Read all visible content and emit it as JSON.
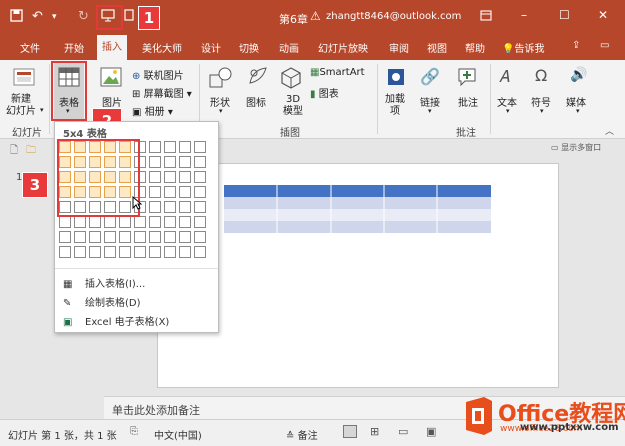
{
  "titlebar": {
    "title": "第6章",
    "account": "zhangtt8464@outlook.com",
    "warning_icon": "warning-icon",
    "window_min": "–",
    "window_max": "☐",
    "window_close": "✕"
  },
  "tabs": [
    "文件",
    "开始",
    "插入",
    "美化大师",
    "设计",
    "切换",
    "动画",
    "幻灯片放映",
    "审阅",
    "视图",
    "帮助"
  ],
  "tell_me": "告诉我",
  "ribbon": {
    "new_slide": "新建\n幻灯片",
    "table": "表格",
    "picture": "图片",
    "online_picture": "联机图片",
    "screenshot": "屏幕截图",
    "album": "相册",
    "shapes": "形状",
    "icons": "图标",
    "model3d": "3D\n模型",
    "smartart": "SmartArt",
    "chart": "图表",
    "addins": "加载\n项",
    "link": "链接",
    "comment": "批注",
    "text": "文本",
    "symbol": "符号",
    "media": "媒体",
    "group_slides": "幻灯片",
    "group_illustrations": "插图",
    "group_comments": "批注",
    "show_multi_window": "显示多窗口"
  },
  "picker": {
    "header": "5x4 表格",
    "cols": 10,
    "rows": 8,
    "sel_cols": 5,
    "sel_rows": 4,
    "insert_table": "插入表格(I)...",
    "draw_table": "绘制表格(D)",
    "excel_table": "Excel 电子表格(X)"
  },
  "callouts": [
    "1",
    "2",
    "3"
  ],
  "thumb_num": "1",
  "notes_placeholder": "单击此处添加备注",
  "status": {
    "slide_count": "幻灯片 第 1 张，共 1 张",
    "language": "中文(中国)",
    "notes": "备注"
  },
  "watermark": {
    "brand": "Office教程网",
    "url": "www.office26.com",
    "site": "www.pptxxw.com"
  }
}
